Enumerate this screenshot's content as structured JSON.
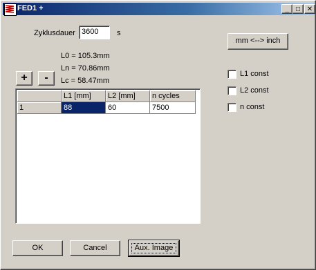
{
  "window": {
    "title": "FED1 +",
    "minimize": "_",
    "maximize": "□",
    "close": "✕"
  },
  "form": {
    "cycle_label": "Zyklusdauer",
    "cycle_value": "3600",
    "cycle_unit": "s",
    "l0": "L0 = 105.3mm",
    "ln": "Ln = 70.86mm",
    "lc": "Lc = 58.47mm",
    "add": "+",
    "remove": "-",
    "unit_toggle": "mm <--> inch"
  },
  "options": {
    "l1_const": "L1 const",
    "l2_const": "L2 const",
    "n_const": "n const"
  },
  "table": {
    "headers": [
      "",
      "L1 [mm]",
      "L2 [mm]",
      "n cycles"
    ],
    "rows": [
      [
        "1",
        "88",
        "60",
        "7500"
      ]
    ]
  },
  "footer": {
    "ok": "OK",
    "cancel": "Cancel",
    "aux": "Aux. Image"
  },
  "colors": {
    "title_start": "#0a246a",
    "title_end": "#a6caf0",
    "selection": "#0a246a",
    "face": "#d4d0c8"
  },
  "icons": {
    "app": "spring-icon"
  }
}
